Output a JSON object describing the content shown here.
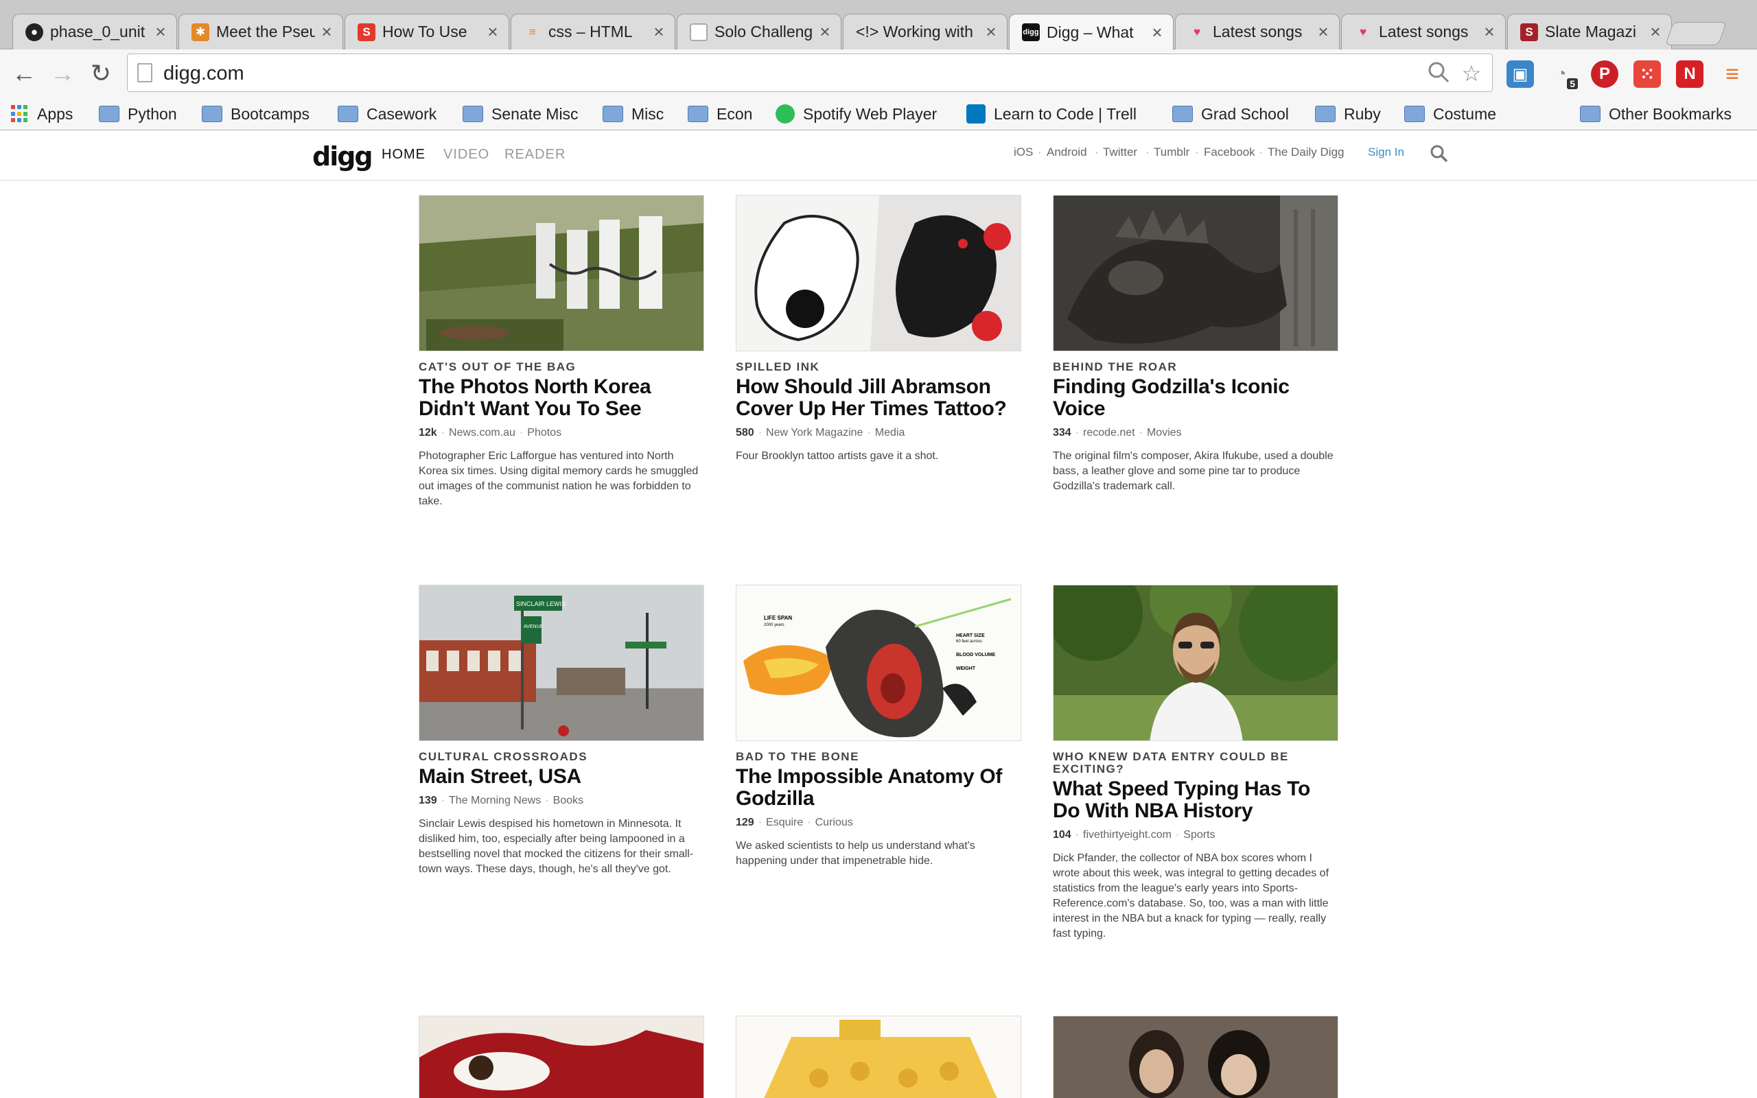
{
  "tabs": [
    {
      "title": "phase_0_unit",
      "favicon": "github-icon"
    },
    {
      "title": "Meet the Pseu",
      "favicon": "asterisk-icon"
    },
    {
      "title": "How To Use",
      "favicon": "slideshare-icon"
    },
    {
      "title": "css – HTML",
      "favicon": "stackoverflow-icon"
    },
    {
      "title": "Solo Challeng",
      "favicon": "page-icon"
    },
    {
      "title": "<!> Working with",
      "favicon": "code-icon"
    },
    {
      "title": "Digg – What",
      "favicon": "digg-icon"
    },
    {
      "title": "Latest songs",
      "favicon": "heart-icon"
    },
    {
      "title": "Latest songs",
      "favicon": "heart-icon"
    },
    {
      "title": "Slate Magazi",
      "favicon": "slate-icon"
    }
  ],
  "tab_close": "×",
  "toolbar": {
    "back": "←",
    "forward": "→",
    "reload": "↻",
    "url": "digg.com",
    "extension_badge": "5"
  },
  "bookmarks": [
    {
      "label": "Apps",
      "icon": "apps-icon"
    },
    {
      "label": "Python",
      "icon": "folder-icon"
    },
    {
      "label": "Bootcamps",
      "icon": "folder-icon"
    },
    {
      "label": "Casework",
      "icon": "folder-icon"
    },
    {
      "label": "Senate Misc",
      "icon": "folder-icon"
    },
    {
      "label": "Misc",
      "icon": "folder-icon"
    },
    {
      "label": "Econ",
      "icon": "folder-icon"
    },
    {
      "label": "Spotify Web Player",
      "icon": "spotify-icon"
    },
    {
      "label": "Learn to Code | Trell",
      "icon": "trello-icon"
    },
    {
      "label": "Grad School",
      "icon": "folder-icon"
    },
    {
      "label": "Ruby",
      "icon": "folder-icon"
    },
    {
      "label": "Costume",
      "icon": "folder-icon"
    },
    {
      "label": "Other Bookmarks",
      "icon": "folder-icon"
    }
  ],
  "digg": {
    "logo": "digg",
    "nav": [
      "HOME",
      "VIDEO",
      "READER"
    ],
    "links": [
      "iOS",
      "Android",
      "Twitter",
      "Tumblr",
      "Facebook",
      "The Daily Digg"
    ],
    "link_separator": "·",
    "signin": "Sign In"
  },
  "stories": [
    {
      "kicker": "CAT'S OUT OF THE BAG",
      "headline": "The Photos North Korea Didn't Want You To See",
      "count": "12k",
      "source": "News.com.au",
      "category": "Photos",
      "description": "Photographer Eric Lafforgue has ventured into North Korea six times. Using digital memory cards he smuggled out images of the communist nation he was forbidden to take."
    },
    {
      "kicker": "SPILLED INK",
      "headline": "How Should Jill Abramson Cover Up Her Times Tattoo?",
      "count": "580",
      "source": "New York Magazine",
      "category": "Media",
      "description": "Four Brooklyn tattoo artists gave it a shot."
    },
    {
      "kicker": "BEHIND THE ROAR",
      "headline": "Finding Godzilla's Iconic Voice",
      "count": "334",
      "source": "recode.net",
      "category": "Movies",
      "description": "The original film's composer, Akira Ifukube, used a double bass, a leather glove and some pine tar to produce Godzilla's trademark call."
    },
    {
      "kicker": "CULTURAL CROSSROADS",
      "headline": "Main Street, USA",
      "count": "139",
      "source": "The Morning News",
      "category": "Books",
      "description": "Sinclair Lewis despised his hometown in Minnesota. It disliked him, too, especially after being lampooned in a bestselling novel that mocked the citizens for their small-town ways. These days, though, he's all they've got."
    },
    {
      "kicker": "BAD TO THE BONE",
      "headline": "The Impossible Anatomy Of Godzilla",
      "count": "129",
      "source": "Esquire",
      "category": "Curious",
      "description": "We asked scientists to help us understand what's happening under that impenetrable hide."
    },
    {
      "kicker": "WHO KNEW DATA ENTRY COULD BE EXCITING?",
      "headline": "What Speed Typing Has To Do With NBA History",
      "count": "104",
      "source": "fivethirtyeight.com",
      "category": "Sports",
      "description": "Dick Pfander, the collector of NBA box scores whom I wrote about this week, was integral to getting decades of statistics from the league's early years into Sports-Reference.com's database. So, too, was a man with little interest in the NBA but a knack for typing — really, really fast typing."
    }
  ],
  "image_text": {
    "street_sign_1": "SINCLAIR LEWIS",
    "street_sign_2": "AVENUE",
    "infographic_1": "LIFE SPAN",
    "infographic_2": "2000 years",
    "infographic_3": "HEART SIZE",
    "infographic_4": "60 feet across",
    "infographic_5": "BLOOD VOLUME",
    "infographic_6": "WEIGHT"
  },
  "colors": {
    "link_blue": "#3a8dc4",
    "digg_black": "#111111"
  }
}
